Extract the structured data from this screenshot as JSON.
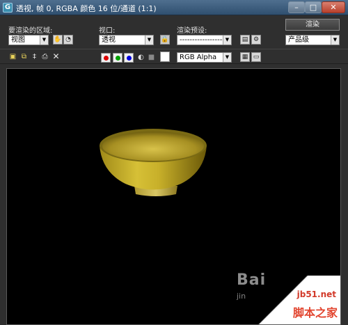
{
  "window": {
    "title": "透视, 帧 0, RGBA 颜色 16 位/通道 (1:1)",
    "minimize": "–",
    "maximize": "□",
    "close": "✕"
  },
  "controls": {
    "area_label": "要渲染的区域:",
    "area_value": "视图",
    "viewport_label": "视口:",
    "viewport_value": "透视",
    "preset_label": "渲染预设:",
    "preset_value": "-------------------",
    "render_button": "渲染",
    "quality_value": "产品级"
  },
  "toolbar": {
    "channel_value": "RGB Alpha",
    "channel_colors": [
      "#dd0000",
      "#00a000",
      "#0000dd"
    ]
  },
  "viewport": {
    "watermark_text": "Bai",
    "watermark_sub": "jin",
    "site_url": "jb51.net",
    "site_name": "脚本之家"
  }
}
